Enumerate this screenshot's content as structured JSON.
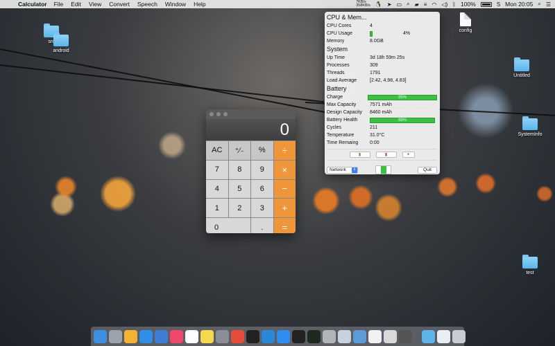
{
  "menubar": {
    "apple_glyph": "",
    "app_name": "Calculator",
    "menus": [
      "File",
      "Edit",
      "View",
      "Convert",
      "Speech",
      "Window",
      "Help"
    ],
    "net_up": "7KB/s",
    "net_down": "358KB/s",
    "battery": "100%",
    "clock": "Mon 20:05"
  },
  "desktop_icons": [
    {
      "name": "src",
      "type": "folder"
    },
    {
      "name": "android",
      "type": "folder"
    },
    {
      "name": "config",
      "type": "document"
    },
    {
      "name": "Untitled",
      "type": "folder"
    },
    {
      "name": "SystemInfo",
      "type": "folder"
    },
    {
      "name": "test",
      "type": "folder"
    }
  ],
  "calculator": {
    "display": "0",
    "keys": [
      {
        "label": "AC",
        "kind": "fn"
      },
      {
        "label": "⁺∕₋",
        "kind": "fn"
      },
      {
        "label": "%",
        "kind": "fn"
      },
      {
        "label": "÷",
        "kind": "op"
      },
      {
        "label": "7",
        "kind": "num"
      },
      {
        "label": "8",
        "kind": "num"
      },
      {
        "label": "9",
        "kind": "num"
      },
      {
        "label": "×",
        "kind": "op"
      },
      {
        "label": "4",
        "kind": "num"
      },
      {
        "label": "5",
        "kind": "num"
      },
      {
        "label": "6",
        "kind": "num"
      },
      {
        "label": "−",
        "kind": "op"
      },
      {
        "label": "1",
        "kind": "num"
      },
      {
        "label": "2",
        "kind": "num"
      },
      {
        "label": "3",
        "kind": "num"
      },
      {
        "label": "+",
        "kind": "op"
      },
      {
        "label": "0",
        "kind": "zero"
      },
      {
        "label": ".",
        "kind": "num"
      },
      {
        "label": "=",
        "kind": "op"
      }
    ]
  },
  "monitor": {
    "cpu_title": "CPU & Mem...",
    "cpu_cores_label": "CPU Cores",
    "cpu_cores": "4",
    "cpu_usage_label": "CPU Usage",
    "cpu_usage": "4%",
    "cpu_usage_fraction": 0.04,
    "memory_label": "Memory",
    "memory": "8.0GB",
    "system_title": "System",
    "uptime_label": "Up Time",
    "uptime": "3d 18h 59m 25s",
    "processes_label": "Processes",
    "processes": "309",
    "threads_label": "Threads",
    "threads": "1791",
    "load_label": "Load Average",
    "load": "[2.42, 4.98, 4.83]",
    "battery_title": "Battery",
    "charge_label": "Charge",
    "charge": "95%",
    "capacity_label": "Max Capacity",
    "capacity": "7571 mAh",
    "design_label": "Design Capacity",
    "design": "8460 mAh",
    "health_label": "Battery Health",
    "health": "89%",
    "cycles_label": "Cycles",
    "cycles": "211",
    "temp_label": "Temperature",
    "temp": "31.0°C",
    "remaining_label": "Time Remaing",
    "remaining": "0:00",
    "add_button": "+",
    "network_select": "Network",
    "quit_button": "Quit"
  },
  "dock_apps": [
    {
      "name": "finder",
      "color": "#3d8fe0"
    },
    {
      "name": "launchpad",
      "color": "#9aa3ad"
    },
    {
      "name": "photos",
      "color": "#f2b233"
    },
    {
      "name": "safari",
      "color": "#2f8fe6"
    },
    {
      "name": "xcode",
      "color": "#3c7ed8"
    },
    {
      "name": "music",
      "color": "#f0476e"
    },
    {
      "name": "calendar",
      "color": "#ffffff"
    },
    {
      "name": "notes",
      "color": "#f6d84f"
    },
    {
      "name": "system-preferences",
      "color": "#8b8f95"
    },
    {
      "name": "chrome",
      "color": "#e64c3c"
    },
    {
      "name": "qq",
      "color": "#222222"
    },
    {
      "name": "vscode",
      "color": "#2a88d8"
    },
    {
      "name": "app-store",
      "color": "#2b8ef0"
    },
    {
      "name": "terminal",
      "color": "#222222"
    },
    {
      "name": "activity-monitor",
      "color": "#1f2a1f"
    },
    {
      "name": "automator",
      "color": "#b0b5ba"
    },
    {
      "name": "preview",
      "color": "#c8d2dc"
    },
    {
      "name": "xcode-tools",
      "color": "#5b9bd8"
    },
    {
      "name": "textedit",
      "color": "#f1f1f1"
    },
    {
      "name": "script-editor",
      "color": "#d9d9d9"
    },
    {
      "name": "calculator",
      "color": "#555555"
    }
  ],
  "dock_right": [
    {
      "name": "downloads-folder",
      "color": "#5cb4ea"
    },
    {
      "name": "preview-doc",
      "color": "#e8eef4"
    },
    {
      "name": "trash",
      "color": "#c9cdd2"
    }
  ]
}
